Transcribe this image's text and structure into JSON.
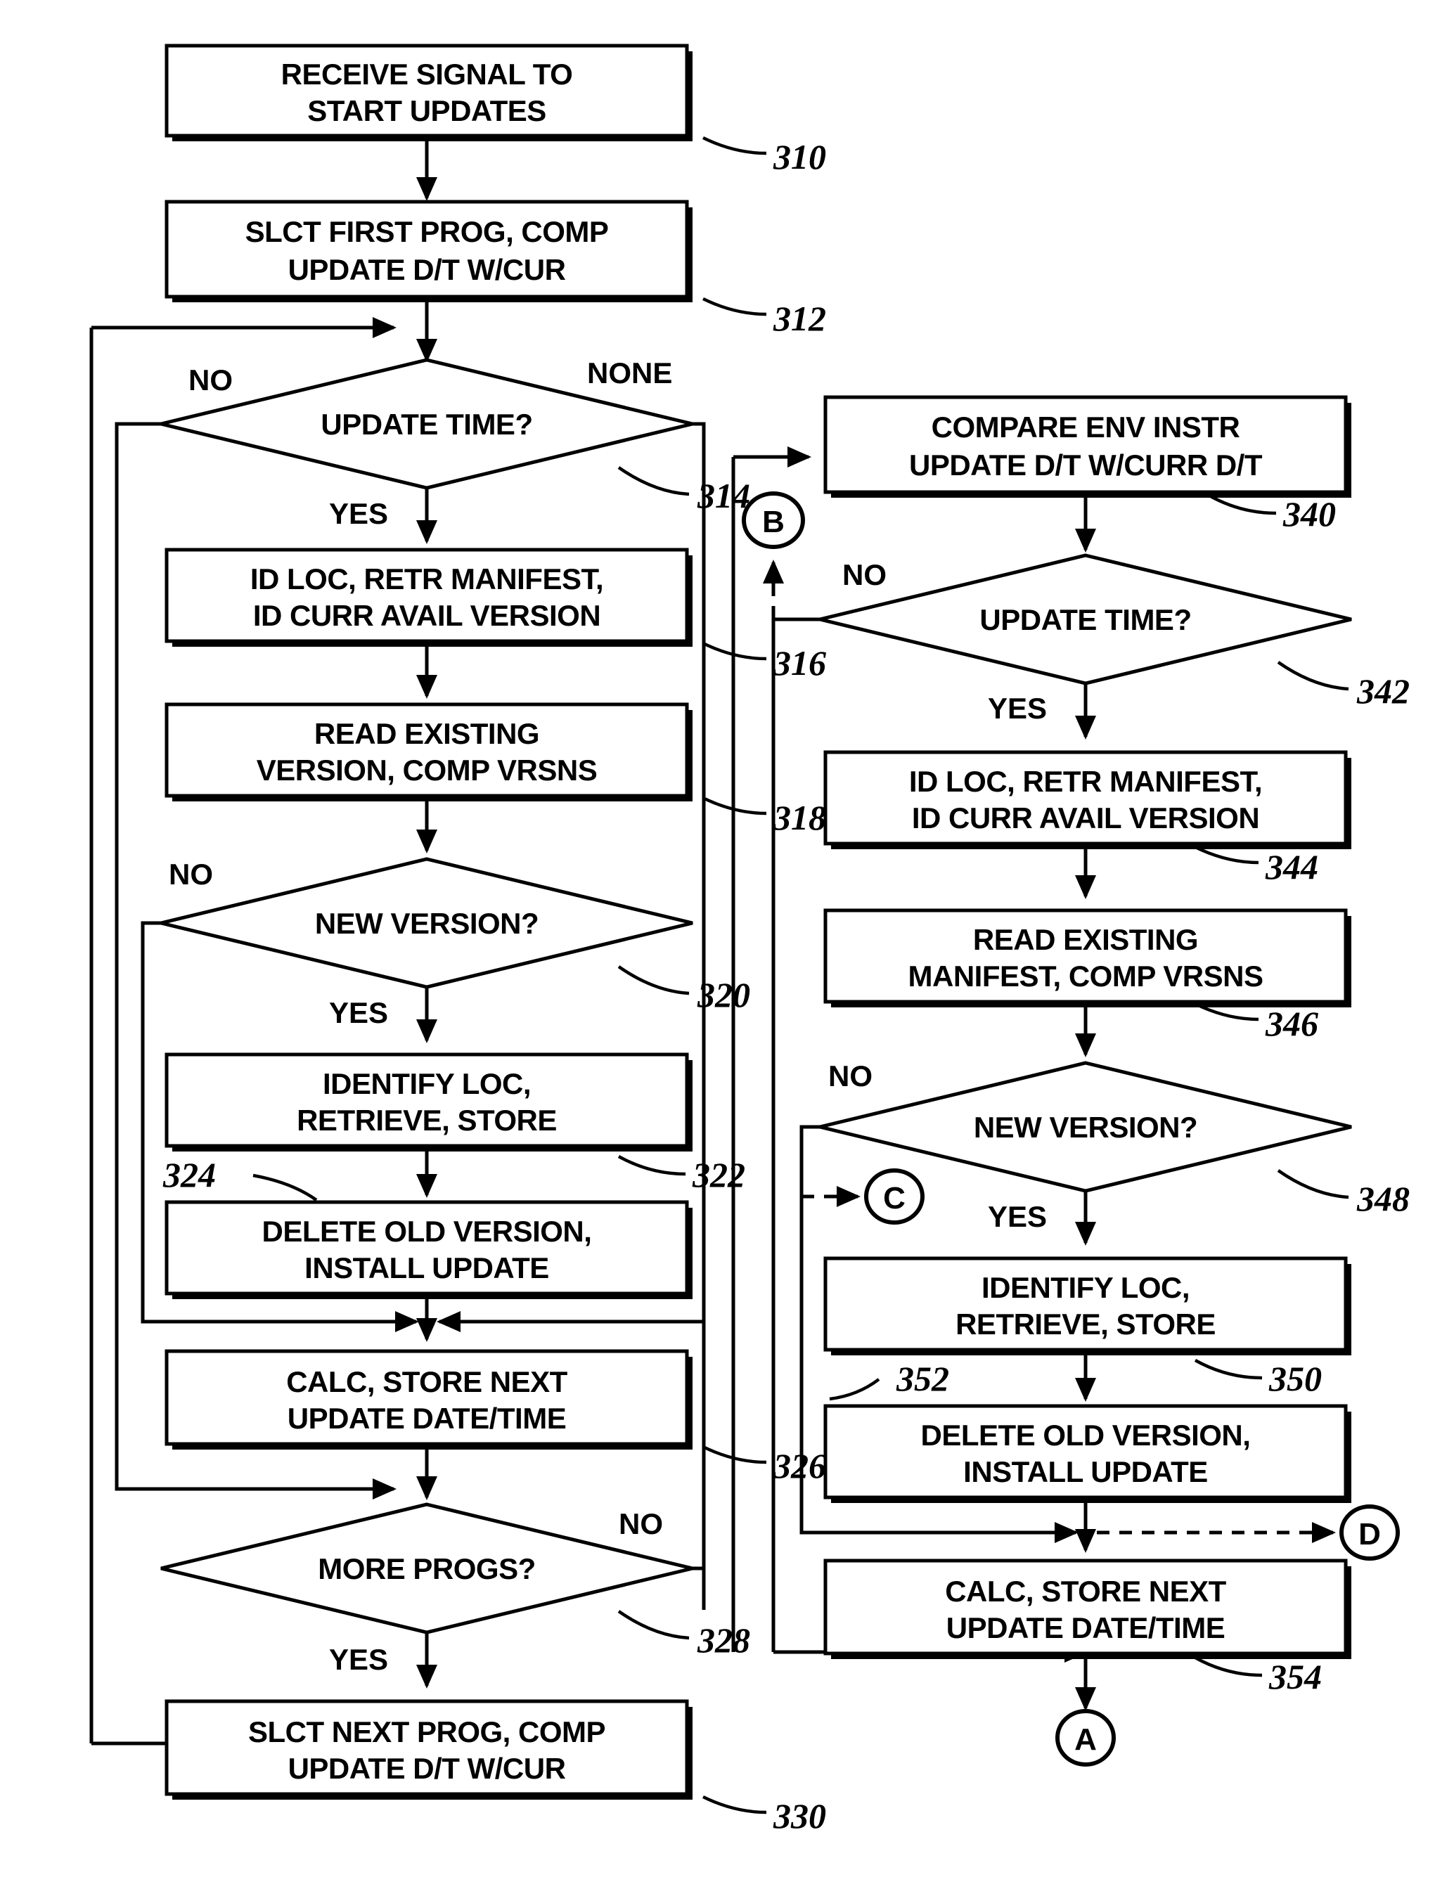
{
  "diagram": {
    "title": "Software update process flowchart",
    "nodes": [
      {
        "id": "n310",
        "ref": "310",
        "type": "process",
        "lines": [
          "RECEIVE SIGNAL TO",
          "START UPDATES"
        ]
      },
      {
        "id": "n312",
        "ref": "312",
        "type": "process",
        "lines": [
          "SLCT FIRST PROG, COMP",
          "UPDATE D/T W/CUR"
        ]
      },
      {
        "id": "n314",
        "ref": "314",
        "type": "decision",
        "lines": [
          "UPDATE TIME?"
        ]
      },
      {
        "id": "n316",
        "ref": "316",
        "type": "process",
        "lines": [
          "ID LOC, RETR MANIFEST,",
          "ID CURR AVAIL VERSION"
        ]
      },
      {
        "id": "n318",
        "ref": "318",
        "type": "process",
        "lines": [
          "READ EXISTING",
          "VERSION, COMP VRSNS"
        ]
      },
      {
        "id": "n320",
        "ref": "320",
        "type": "decision",
        "lines": [
          "NEW VERSION?"
        ]
      },
      {
        "id": "n322",
        "ref": "322",
        "type": "process",
        "lines": [
          "IDENTIFY LOC,",
          "RETRIEVE, STORE"
        ]
      },
      {
        "id": "n324",
        "ref": "324",
        "type": "process",
        "lines": [
          "DELETE OLD VERSION,",
          "INSTALL UPDATE"
        ]
      },
      {
        "id": "n326",
        "ref": "326",
        "type": "process",
        "lines": [
          "CALC, STORE NEXT",
          "UPDATE DATE/TIME"
        ]
      },
      {
        "id": "n328",
        "ref": "328",
        "type": "decision",
        "lines": [
          "MORE PROGS?"
        ]
      },
      {
        "id": "n330",
        "ref": "330",
        "type": "process",
        "lines": [
          "SLCT NEXT PROG, COMP",
          "UPDATE D/T W/CUR"
        ]
      },
      {
        "id": "n340",
        "ref": "340",
        "type": "process",
        "lines": [
          "COMPARE ENV INSTR",
          "UPDATE D/T W/CURR D/T"
        ]
      },
      {
        "id": "n342",
        "ref": "342",
        "type": "decision",
        "lines": [
          "UPDATE TIME?"
        ]
      },
      {
        "id": "n344",
        "ref": "344",
        "type": "process",
        "lines": [
          "ID LOC, RETR MANIFEST,",
          "ID CURR AVAIL VERSION"
        ]
      },
      {
        "id": "n346",
        "ref": "346",
        "type": "process",
        "lines": [
          "READ EXISTING",
          "MANIFEST, COMP VRSNS"
        ]
      },
      {
        "id": "n348",
        "ref": "348",
        "type": "decision",
        "lines": [
          "NEW VERSION?"
        ]
      },
      {
        "id": "n350",
        "ref": "350",
        "type": "process",
        "lines": [
          "IDENTIFY LOC,",
          "RETRIEVE, STORE"
        ]
      },
      {
        "id": "n352",
        "ref": "352",
        "type": "process",
        "lines": [
          "DELETE OLD VERSION,",
          "INSTALL UPDATE"
        ]
      },
      {
        "id": "n354",
        "ref": "354",
        "type": "process",
        "lines": [
          "CALC, STORE NEXT",
          "UPDATE DATE/TIME"
        ]
      }
    ],
    "edge_labels": {
      "l314_no": "NO",
      "l314_none": "NONE",
      "l314_yes": "YES",
      "l320_no": "NO",
      "l320_yes": "YES",
      "l328_no": "NO",
      "l328_yes": "YES",
      "l342_no": "NO",
      "l342_yes": "YES",
      "l348_no": "NO",
      "l348_yes": "YES"
    },
    "connectors": [
      {
        "id": "connA",
        "label": "A"
      },
      {
        "id": "connB",
        "label": "B"
      },
      {
        "id": "connC",
        "label": "C"
      },
      {
        "id": "connD",
        "label": "D"
      }
    ],
    "text": {
      "n310_l1": "RECEIVE SIGNAL TO",
      "n310_l2": "START UPDATES",
      "n312_l1": "SLCT FIRST PROG, COMP",
      "n312_l2": "UPDATE D/T W/CUR",
      "n314_l1": "UPDATE TIME?",
      "n316_l1": "ID LOC, RETR MANIFEST,",
      "n316_l2": "ID CURR AVAIL VERSION",
      "n318_l1": "READ EXISTING",
      "n318_l2": "VERSION, COMP VRSNS",
      "n320_l1": "NEW VERSION?",
      "n322_l1": "IDENTIFY LOC,",
      "n322_l2": "RETRIEVE, STORE",
      "n324_l1": "DELETE OLD VERSION,",
      "n324_l2": "INSTALL UPDATE",
      "n326_l1": "CALC, STORE NEXT",
      "n326_l2": "UPDATE DATE/TIME",
      "n328_l1": "MORE PROGS?",
      "n330_l1": "SLCT NEXT PROG, COMP",
      "n330_l2": "UPDATE D/T W/CUR",
      "n340_l1": "COMPARE ENV INSTR",
      "n340_l2": "UPDATE D/T W/CURR D/T",
      "n342_l1": "UPDATE TIME?",
      "n344_l1": "ID LOC, RETR MANIFEST,",
      "n344_l2": "ID CURR AVAIL VERSION",
      "n346_l1": "READ EXISTING",
      "n346_l2": "MANIFEST, COMP VRSNS",
      "n348_l1": "NEW VERSION?",
      "n350_l1": "IDENTIFY LOC,",
      "n350_l2": "RETRIEVE, STORE",
      "n352_l1": "DELETE OLD VERSION,",
      "n352_l2": "INSTALL UPDATE",
      "n354_l1": "CALC, STORE NEXT",
      "n354_l2": "UPDATE DATE/TIME"
    },
    "refs": {
      "r310": "310",
      "r312": "312",
      "r314": "314",
      "r316": "316",
      "r318": "318",
      "r320": "320",
      "r322": "322",
      "r324": "324",
      "r326": "326",
      "r328": "328",
      "r330": "330",
      "r340": "340",
      "r342": "342",
      "r344": "344",
      "r346": "346",
      "r348": "348",
      "r350": "350",
      "r352": "352",
      "r354": "354"
    },
    "colors": {
      "stroke": "#000000",
      "fill": "#ffffff"
    }
  }
}
